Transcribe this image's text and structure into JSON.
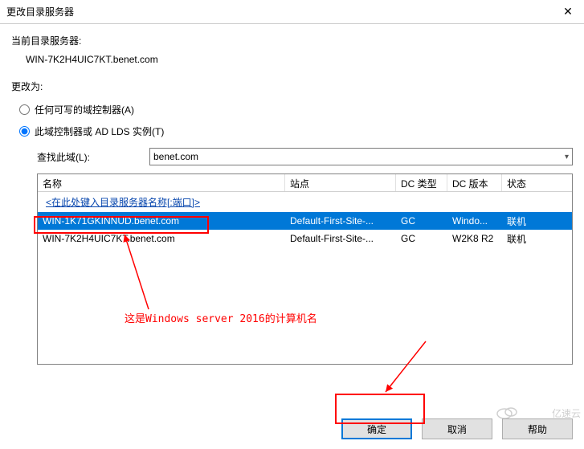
{
  "window": {
    "title": "更改目录服务器",
    "close_icon": "✕"
  },
  "current": {
    "label": "当前目录服务器:",
    "value": "WIN-7K2H4UIC7KT.benet.com"
  },
  "changeto": {
    "label": "更改为:",
    "radio_any": "任何可写的域控制器(A)",
    "radio_this": "此域控制器或 AD LDS 实例(T)"
  },
  "lookup": {
    "label": "查找此域(L):",
    "value": "benet.com"
  },
  "table": {
    "headers": {
      "name": "名称",
      "site": "站点",
      "dctype": "DC 类型",
      "dcver": "DC 版本",
      "status": "状态"
    },
    "hint": "<在此处键入目录服务器名称[:端口]>",
    "rows": [
      {
        "name": "WIN-1K71GKINNUD.benet.com",
        "site": "Default-First-Site-...",
        "dctype": "GC",
        "dcver": "Windo...",
        "status": "联机",
        "selected": true
      },
      {
        "name": "WIN-7K2H4UIC7KT.benet.com",
        "site": "Default-First-Site-...",
        "dctype": "GC",
        "dcver": "W2K8 R2",
        "status": "联机",
        "selected": false
      }
    ]
  },
  "buttons": {
    "ok": "确定",
    "cancel": "取消",
    "help": "帮助"
  },
  "annotation": {
    "text": "这是Windows server 2016的计算机名"
  },
  "watermark": {
    "text": "亿速云"
  }
}
